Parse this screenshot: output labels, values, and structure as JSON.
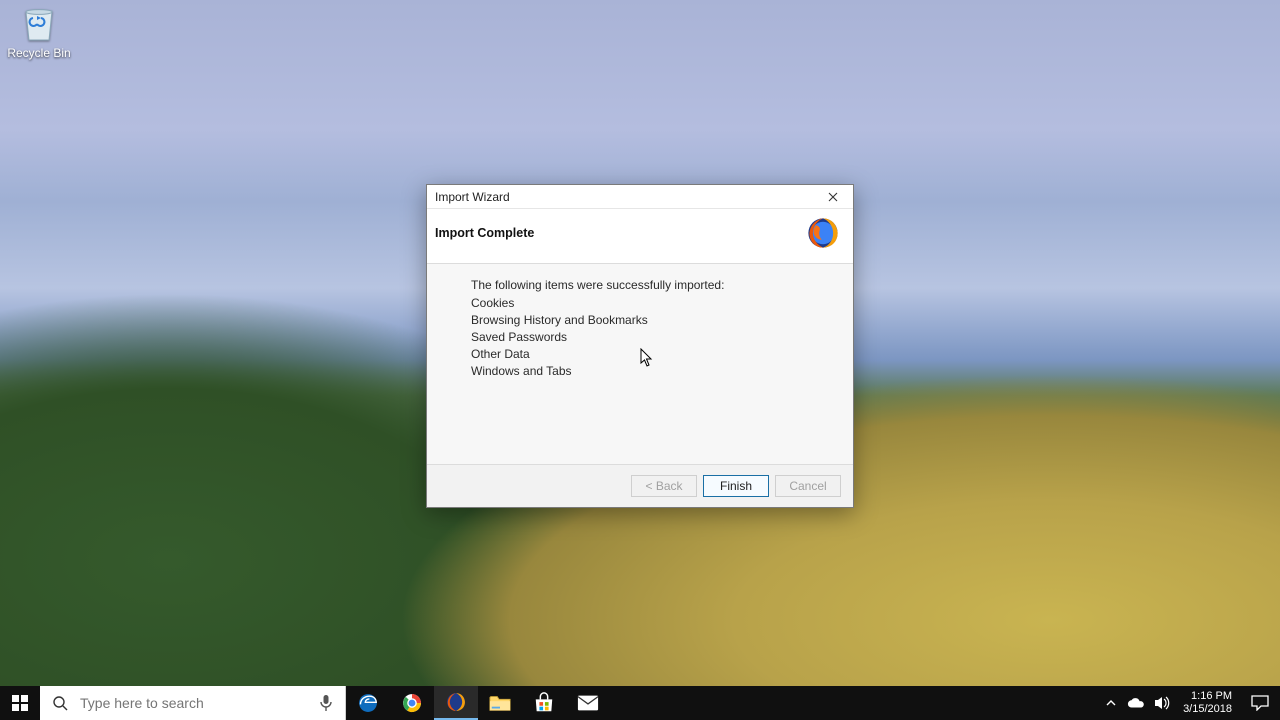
{
  "desktop": {
    "recycle_bin_label": "Recycle Bin"
  },
  "dialog": {
    "title": "Import Wizard",
    "heading": "Import Complete",
    "message": "The following items were successfully imported:",
    "items": [
      "Cookies",
      "Browsing History and Bookmarks",
      "Saved Passwords",
      "Other Data",
      "Windows and Tabs"
    ],
    "buttons": {
      "back": "< Back",
      "finish": "Finish",
      "cancel": "Cancel"
    }
  },
  "taskbar": {
    "search_placeholder": "Type here to search",
    "time": "1:16 PM",
    "date": "3/15/2018"
  }
}
